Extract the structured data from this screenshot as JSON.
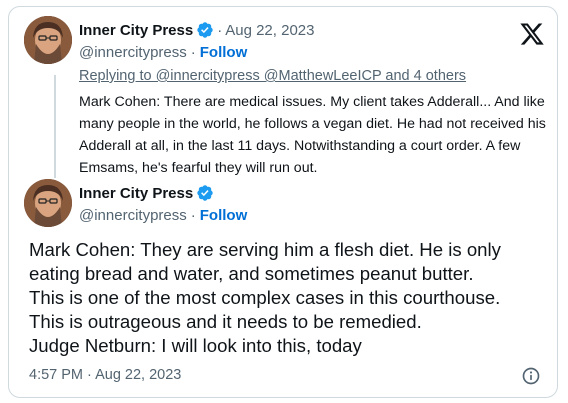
{
  "quoted_tweet": {
    "display_name": "Inner City Press",
    "date": "Aug 22, 2023",
    "handle": "@innercitypress",
    "follow_label": "Follow",
    "replying_to": "Replying to @innercitypress @MatthewLeeICP and 4 others",
    "text": "Mark Cohen: There are medical issues. My client takes Adderall... And like many people in the world, he follows a vegan diet. He had not received his Adderall at all, in the last 11 days. Notwithstanding a court order. A few Emsams, he's fearful they will run out."
  },
  "main_tweet": {
    "display_name": "Inner City Press",
    "handle": "@innercitypress",
    "follow_label": "Follow",
    "text": "Mark Cohen: They are serving him a flesh diet. He is only eating bread and water, and sometimes peanut butter.\nThis is one of the most complex cases in this courthouse.\nThis is outrageous and it needs to be remedied.\nJudge Netburn: I will look into this, today",
    "timestamp": "4:57 PM · Aug 22, 2023"
  },
  "icons": {
    "logo": "x-logo-icon",
    "verified": "verified-badge-icon",
    "info": "info-icon"
  },
  "colors": {
    "verified_blue": "#1d9bf0",
    "follow_blue": "#006fd6",
    "muted_gray": "#536471",
    "border": "#cfd9de"
  }
}
